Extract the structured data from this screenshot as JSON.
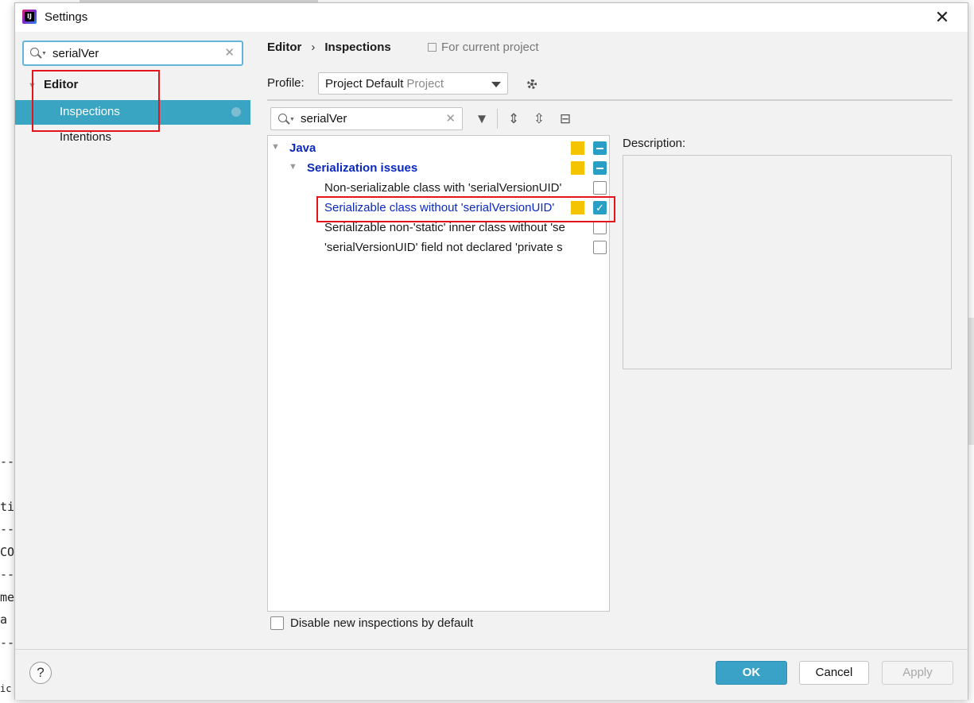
{
  "window": {
    "title": "Settings"
  },
  "left": {
    "search_value": "serialVer",
    "tree": {
      "editor": "Editor",
      "inspections": "Inspections",
      "intentions": "Intentions"
    }
  },
  "breadcrumb": {
    "parent": "Editor",
    "separator": "›",
    "current": "Inspections"
  },
  "scope_label": "For current project",
  "profile": {
    "label": "Profile:",
    "value": "Project Default",
    "sub": "Project"
  },
  "inspection_search": {
    "value": "serialVer"
  },
  "tree": {
    "java": "Java",
    "group": "Serialization issues",
    "items": [
      "Non-serializable class with 'serialVersionUID'",
      "Serializable class without 'serialVersionUID'",
      "Serializable non-'static' inner class without 'se",
      "'serialVersionUID' field not declared 'private s"
    ]
  },
  "description_label": "Description:",
  "disable_label": "Disable new inspections by default",
  "buttons": {
    "ok": "OK",
    "cancel": "Cancel",
    "apply": "Apply",
    "help": "?"
  },
  "background_editor": [
    "--",
    "ti",
    "--",
    "CO",
    "--",
    "me",
    " a",
    "--",
    "ic"
  ],
  "colors": {
    "accent": "#3aa5c3",
    "selected_text": "#0b28bf",
    "severity_warning": "#f5c400",
    "highlight_box": "#e5141b"
  }
}
